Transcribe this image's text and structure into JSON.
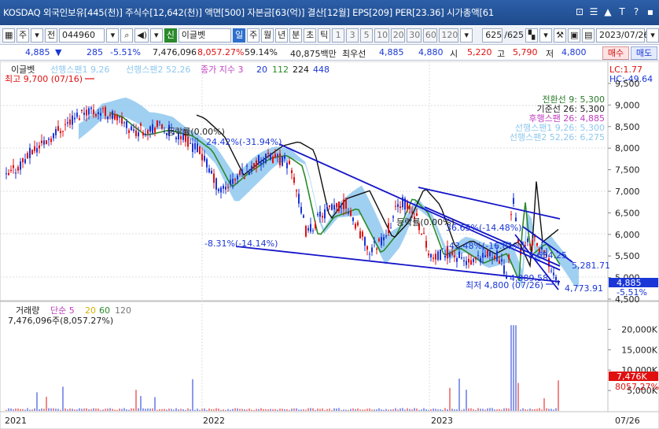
{
  "window": {
    "title": "KOSDAQ 외국인보유[445(천)] 주식수[12,642(천)] 액면[500] 자본금[63(억)] 결산[12월] EPS[209] PER[23.36] 시가총액[61",
    "controls": [
      "⊡",
      "☰",
      "▲",
      "T",
      "?",
      "▪"
    ]
  },
  "toolbar": {
    "menu_label": "주",
    "jeon_label": "전",
    "code": "044960",
    "stock_name": "이글벳",
    "period_buttons": [
      "일",
      "주",
      "월",
      "년",
      "분",
      "초",
      "틱"
    ],
    "interval_buttons": [
      "1",
      "3",
      "5",
      "10",
      "20",
      "30",
      "60",
      "120"
    ],
    "count": "625",
    "count_total": "/625",
    "date": "2023/07/26"
  },
  "quote": {
    "price": "4,885",
    "change_arrow": "▼",
    "change": "285",
    "change_pct": "-5.51%",
    "volume": "7,476,096",
    "vol_ratio": "8,057.27%",
    "turnover": "59.14%",
    "amount": "40,875백만",
    "best_ask_label": "최우선",
    "best_ask": "4,885",
    "best_bid": "4,880",
    "open_label": "시",
    "open": "5,220",
    "high_label": "고",
    "high": "5,790",
    "low_label": "저",
    "low": "4,800",
    "buy_label": "매수",
    "sell_label": "매도"
  },
  "price_panel": {
    "legend": {
      "name": "이글벳",
      "lead1": "선행스팬1 9,26",
      "lead2": "선행스팬2 52,26",
      "close_index": "종가 지수 3",
      "ma_values": [
        "20",
        "112",
        "224",
        "448"
      ]
    },
    "lc_label": "LC:1.77",
    "hc_label": "HC:-49.64",
    "high_annotation": "최고 9,700 (07/16)",
    "low_annotation": "최저 4,800 (07/26)",
    "ichimoku": [
      {
        "text": "전환선 9: 5,300",
        "color": "#2a7a2a"
      },
      {
        "text": "기준선 26: 5,300",
        "color": "#222222"
      },
      {
        "text": "후행스팬 26: 4,885",
        "color": "#c040c0"
      },
      {
        "text": "선행스팬1 9,26: 5,300",
        "color": "#8fc8ee"
      },
      {
        "text": "선행스팬2 52,26: 6,275",
        "color": "#8fc8ee"
      }
    ],
    "annotations": {
      "a1": "등락률(0.00%)",
      "a2": "24.42%(-31.94%)",
      "a3": "-8.31%(-14.14%)",
      "a4": "등락률(0.00%)",
      "a5": "36.65%(-14.48%)",
      "a6": "-43.48%(-16.81%)",
      "a7": "5,654.25",
      "a8": "5,281.71",
      "a9": "4,989.58",
      "a10": "4,773.91"
    },
    "y_ticks": [
      "9,500",
      "9,000",
      "8,500",
      "8,000",
      "7,500",
      "7,000",
      "6,500",
      "6,000",
      "5,500",
      "5,000",
      "4,500"
    ],
    "current_price_label": "4,885",
    "current_pct_label": "-5.51%"
  },
  "volume_panel": {
    "legend": {
      "name": "거래량",
      "simple": "단순 5",
      "ma20": "20",
      "ma60": "60",
      "ma120": "120"
    },
    "sub_label": "7,476,096주(8,057.27%)",
    "y_ticks": [
      "20,000K",
      "15,000K",
      "10,000K",
      "5,000K"
    ],
    "current_label": "7,476K",
    "current_pct": "8057.27%"
  },
  "x_axis": {
    "labels": [
      "2021",
      "2022",
      "2023"
    ],
    "right_label": "07/26"
  },
  "colors": {
    "candle_up": "#e01010",
    "candle_down": "#1a36d6",
    "cloud": "#8fc8ee",
    "ma_short": "#2a8a2a",
    "ma_long": "#111111",
    "trend": "#1414c8"
  }
}
